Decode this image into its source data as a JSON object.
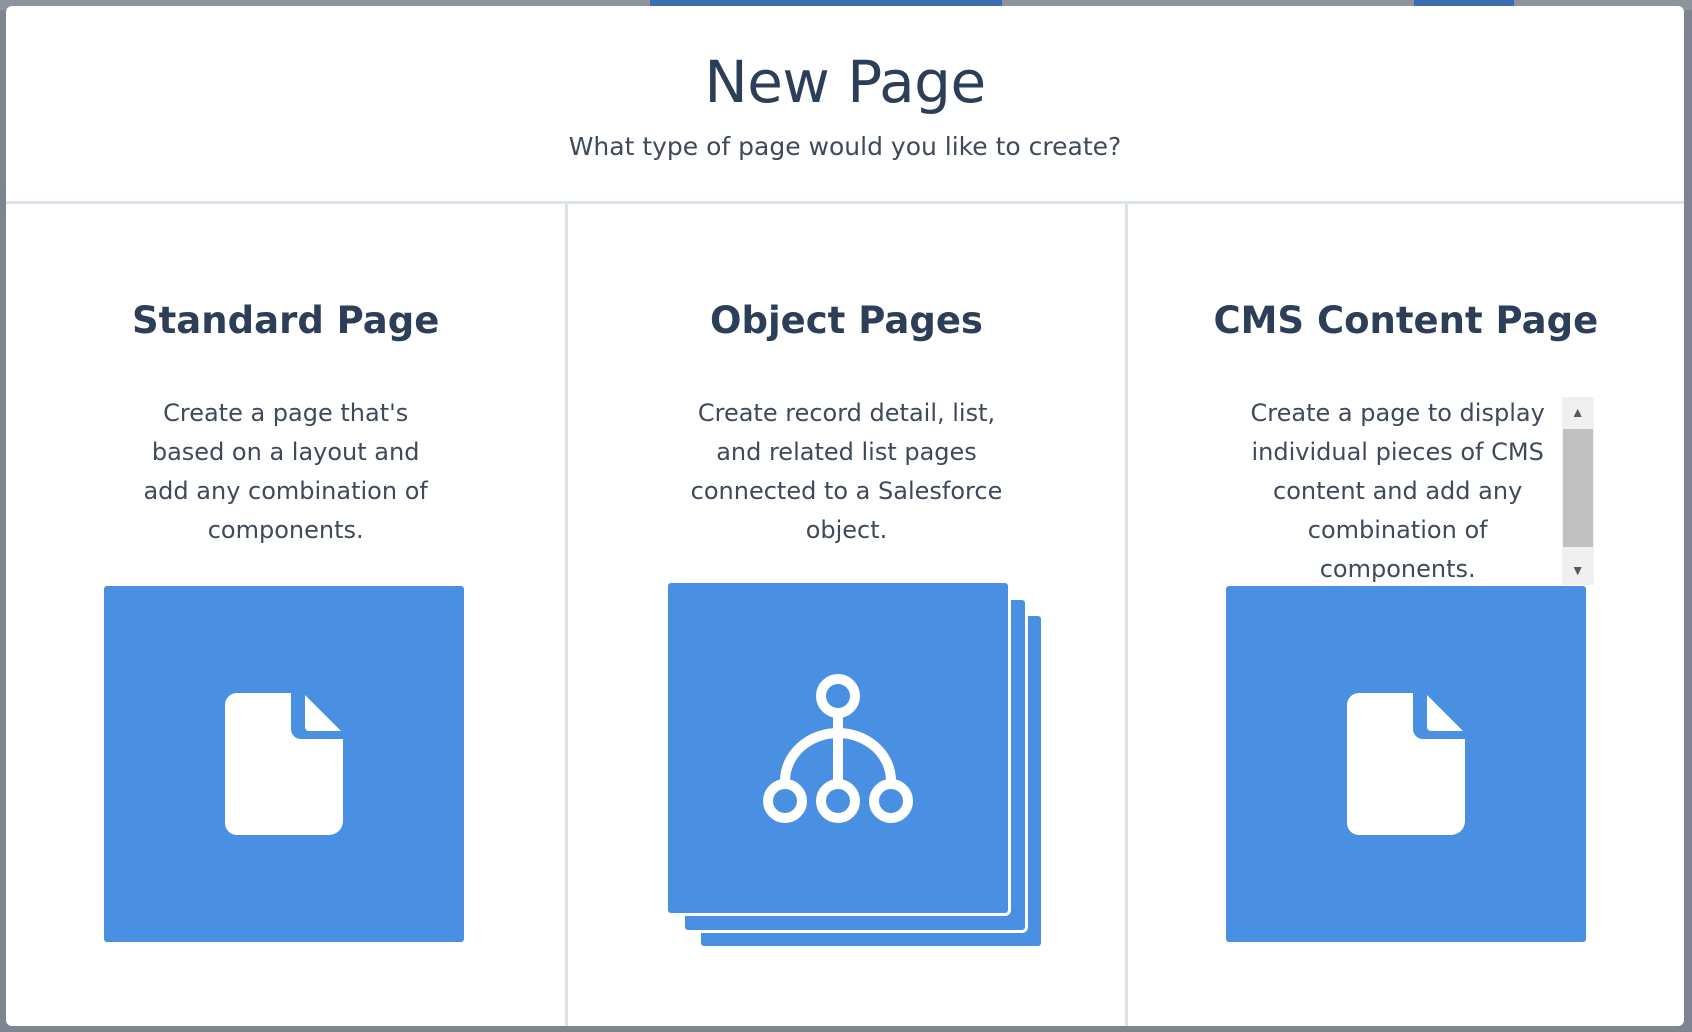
{
  "modal": {
    "title": "New Page",
    "subtitle": "What type of page would you like to create?"
  },
  "options": [
    {
      "title": "Standard Page",
      "description": "Create a page that's based on a layout and add any combination of components.",
      "icon": "page-icon"
    },
    {
      "title": "Object Pages",
      "description": "Create record detail, list, and related list pages connected to a Salesforce object.",
      "icon": "hierarchy-icon"
    },
    {
      "title": "CMS Content Page",
      "description": "Create a page to display individual pieces of CMS content and add any combination of components.",
      "icon": "page-icon"
    }
  ],
  "colors": {
    "tile": "#4a90e2",
    "title_text": "#2c3e58",
    "divider": "#dde3eb"
  }
}
